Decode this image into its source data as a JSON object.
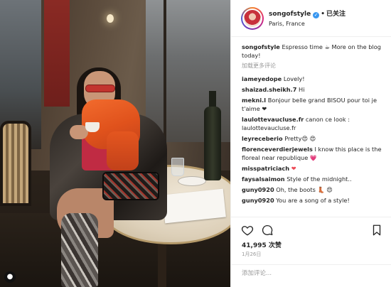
{
  "post": {
    "username": "songofstyle",
    "follow_label": "已关注",
    "location": "Paris, France"
  },
  "comments": [
    {
      "user": "songofstyle",
      "text": "Espresso time ☕  More on the blog today!"
    },
    {
      "user": "iameyedope",
      "text": "Lovely!"
    },
    {
      "user": "shaizad.sheikh.7",
      "text": "Hi"
    },
    {
      "user": "mekni.l",
      "text": "Bonjour belle grand BISOU pour toi je t'aime ❤"
    },
    {
      "user": "laulottevaucluse.fr",
      "text": "canon ce look : laulottevaucluse.fr"
    },
    {
      "user": "leyreceberio",
      "text": "Pretty😍 😍"
    },
    {
      "user": "florenceverdierjewels",
      "text": "I know this place is the floreal near republique 💗"
    },
    {
      "user": "misspatriciach",
      "text": "❤"
    },
    {
      "user": "faysalsaimon",
      "text": "Style of the midnight.."
    },
    {
      "user": "guny0920",
      "text": "Oh, the boots 👢 😍"
    },
    {
      "user": "guny0920",
      "text": "You are a song of a style!"
    }
  ],
  "load_more_label": "加载更多评论",
  "likes": "41,995 次赞",
  "date": "1月26日",
  "add_comment_placeholder": "添加评论..."
}
